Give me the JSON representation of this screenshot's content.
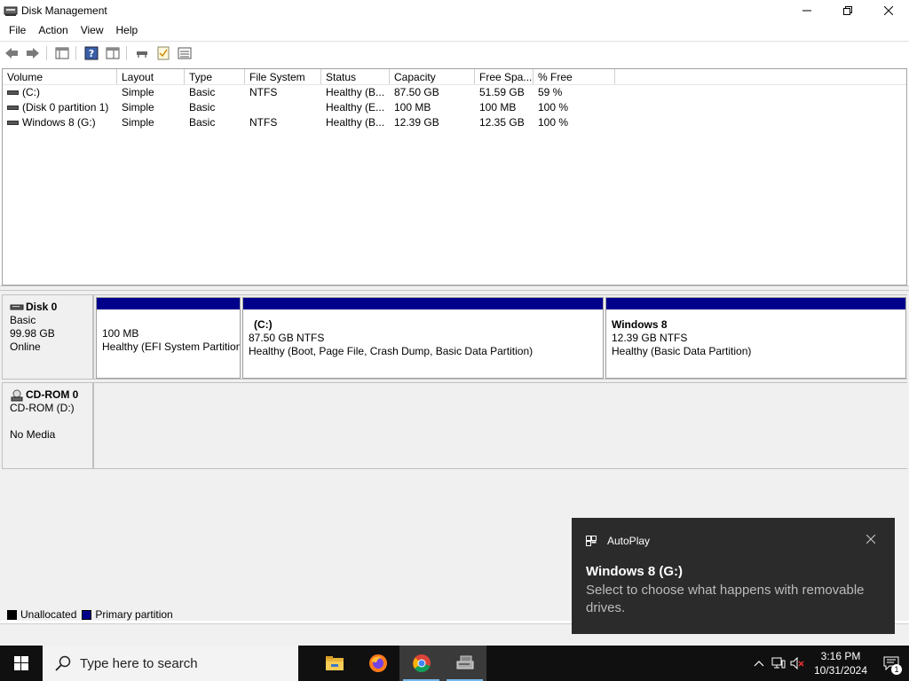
{
  "window": {
    "title": "Disk Management"
  },
  "menu": [
    "File",
    "Action",
    "View",
    "Help"
  ],
  "volume_list": {
    "columns": [
      "Volume",
      "Layout",
      "Type",
      "File System",
      "Status",
      "Capacity",
      "Free Spa...",
      "% Free"
    ],
    "rows": [
      [
        "(C:)",
        "Simple",
        "Basic",
        "NTFS",
        "Healthy (B...",
        "87.50 GB",
        "51.59 GB",
        "59 %"
      ],
      [
        "(Disk 0 partition 1)",
        "Simple",
        "Basic",
        "",
        "Healthy (E...",
        "100 MB",
        "100 MB",
        "100 %"
      ],
      [
        "Windows 8 (G:)",
        "Simple",
        "Basic",
        "NTFS",
        "Healthy (B...",
        "12.39 GB",
        "12.35 GB",
        "100 %"
      ]
    ]
  },
  "disks": {
    "disk0": {
      "name": "Disk 0",
      "type": "Basic",
      "size": "99.98 GB",
      "status": "Online",
      "partitions": [
        {
          "name": "",
          "size": "100 MB",
          "status": "Healthy (EFI System Partition)"
        },
        {
          "name": "(C:)",
          "size": "87.50 GB NTFS",
          "status": "Healthy (Boot, Page File, Crash Dump, Basic Data Partition)"
        },
        {
          "name": "Windows 8",
          "size": "12.39 GB NTFS",
          "status": "Healthy (Basic Data Partition)"
        }
      ]
    },
    "cdrom0": {
      "name": "CD-ROM 0",
      "drive": "CD-ROM (D:)",
      "media": "No Media"
    }
  },
  "legend": {
    "unallocated": "Unallocated",
    "primary": "Primary partition",
    "primary_color": "#00008b"
  },
  "toast": {
    "app": "AutoPlay",
    "title": "Windows 8 (G:)",
    "message": "Select to choose what happens with removable drives."
  },
  "taskbar": {
    "search_placeholder": "Type here to search",
    "time": "3:16 PM",
    "date": "10/31/2024",
    "notification_count": "1"
  }
}
